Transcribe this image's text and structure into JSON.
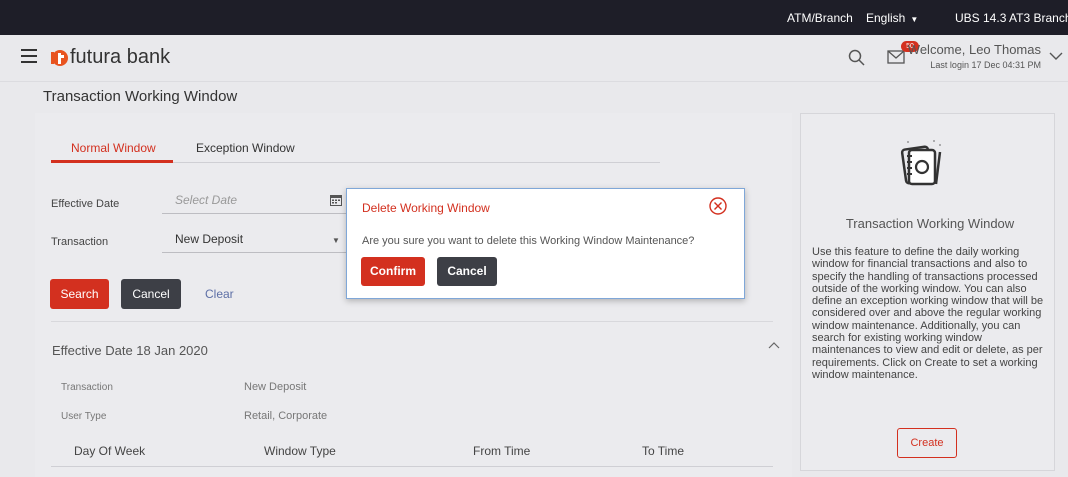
{
  "topbar": {
    "location": "ATM/Branch",
    "language": "English",
    "branch": "UBS 14.3 AT3 Branch"
  },
  "header": {
    "brand": "futura bank",
    "notification_count": "50",
    "welcome": "Welcome, Leo Thomas",
    "last_login": "Last login 17 Dec 04:31 PM"
  },
  "page": {
    "title": "Transaction Working Window"
  },
  "tabs": [
    {
      "label": "Normal Window",
      "active": true
    },
    {
      "label": "Exception Window",
      "active": false
    }
  ],
  "form": {
    "effective_date_label": "Effective Date",
    "effective_date_placeholder": "Select Date",
    "transaction_label": "Transaction",
    "transaction_value": "New Deposit"
  },
  "actions": {
    "search": "Search",
    "cancel": "Cancel",
    "clear": "Clear"
  },
  "result": {
    "effective_date_title": "Effective Date  18 Jan 2020",
    "details": [
      {
        "label": "Transaction",
        "value": "New Deposit"
      },
      {
        "label": "User Type",
        "value": "Retail, Corporate"
      }
    ],
    "columns": [
      "Day Of Week",
      "Window Type",
      "From Time",
      "To Time"
    ]
  },
  "help": {
    "title": "Transaction Working Window",
    "text": "Use this feature to define the daily working window for financial transactions and also to specify the handling of transactions processed outside of the working window. You can also define an exception working window that will be considered over and above the regular working window maintenance. Additionally, you can search for existing working window maintenances to view and edit or delete, as per requirements. Click on Create to set a working window maintenance.",
    "create": "Create"
  },
  "modal": {
    "title": "Delete Working Window",
    "message": "Are you sure you want to delete this Working Window Maintenance?",
    "confirm": "Confirm",
    "cancel": "Cancel"
  },
  "colors": {
    "accent": "#d3301f",
    "dark": "#1e1e28",
    "button_dark": "#3d3f46",
    "background": "#e9e9ec"
  }
}
